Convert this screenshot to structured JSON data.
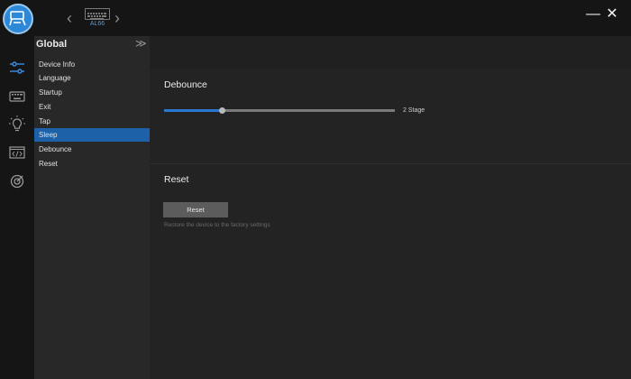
{
  "device": {
    "name": "AL66"
  },
  "window": {
    "minimize_glyph": "—",
    "close_glyph": "✕"
  },
  "nav": {
    "prev_glyph": "‹",
    "next_glyph": "›"
  },
  "iconbar": {
    "items": [
      {
        "name": "settings-sliders-icon",
        "active": true
      },
      {
        "name": "keyboard-icon",
        "active": false
      },
      {
        "name": "lightbulb-icon",
        "active": false
      },
      {
        "name": "code-icon",
        "active": false
      },
      {
        "name": "target-icon",
        "active": false
      }
    ]
  },
  "menu": {
    "title": "Global",
    "collapse_glyph": "≫",
    "items": [
      "Device Info",
      "Language",
      "Startup",
      "Exit",
      "Tap",
      "Sleep",
      "Debounce",
      "Reset"
    ],
    "active_index": 5
  },
  "debounce": {
    "title": "Debounce",
    "value_label": "2 Stage",
    "slider_fraction": 0.25
  },
  "reset": {
    "title": "Reset",
    "button_label": "Reset",
    "description": "Restore the device to the factory settings"
  },
  "colors": {
    "accent": "#2b78d0",
    "menu_active": "#1d62a8",
    "icon_active": "#3a8fe8",
    "icon_inactive": "#9a9a9a"
  }
}
